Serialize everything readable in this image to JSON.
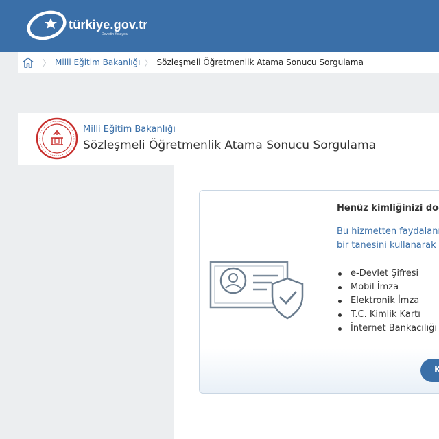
{
  "header": {
    "logo_text": "türkiye.gov.tr",
    "logo_tagline": "Devletin Kısayolu",
    "colors": {
      "topbar": "#3a6fa8",
      "accent": "#3a6fa8"
    }
  },
  "breadcrumb": {
    "home_icon": "home-icon",
    "items": [
      "Milli Eğitim Bakanlığı",
      "Sözleşmeli Öğretmenlik Atama Sonucu Sorgulama"
    ]
  },
  "service": {
    "ministry": "Milli Eğitim Bakanlığı",
    "title": "Sözleşmeli Öğretmenlik Atama Sonucu Sorgulama",
    "seal_icon": "meb-seal-icon"
  },
  "login": {
    "title": "Henüz kimliğinizi doğru",
    "desc_line1": "Bu hizmetten faydalanm",
    "desc_line2": "bir tanesini kullanarak s",
    "illustration_icon": "id-card-shield-icon",
    "methods": [
      "e-Devlet Şifresi",
      "Mobil İmza",
      "Elektronik İmza",
      "T.C. Kimlik Kartı",
      "İnternet Bankacılığı"
    ],
    "button_label": "K"
  }
}
